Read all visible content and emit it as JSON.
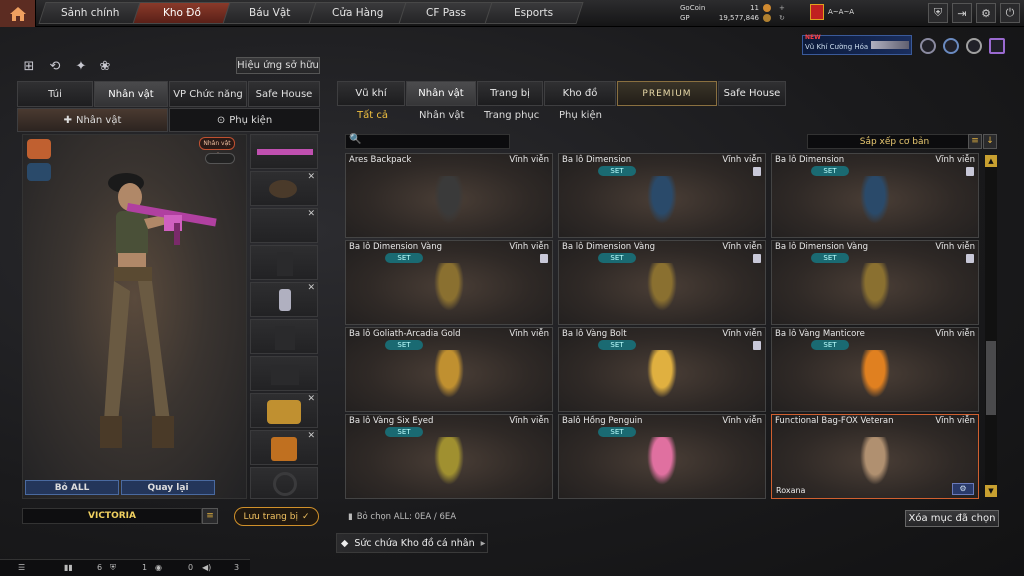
{
  "nav": {
    "tabs": [
      "Sảnh chính",
      "Kho Đồ",
      "Báu Vật",
      "Cửa Hàng",
      "CF Pass",
      "Esports"
    ],
    "active": "Kho Đồ"
  },
  "currency": {
    "gocoin_label": "GoCoin",
    "gocoin": "11",
    "gp_label": "GP",
    "gp": "19,577,846"
  },
  "player": {
    "nick": "A~A~A"
  },
  "promo": {
    "new": "NEW",
    "text": "Vũ Khí Cường Hóa"
  },
  "left": {
    "effects_button": "Hiệu ứng sở hữu",
    "tabs": [
      "Túi",
      "Nhân vật",
      "VP Chức năng",
      "Safe House"
    ],
    "subtabs": [
      "Nhân vật",
      "Phụ kiện"
    ],
    "char_badge": "Nhân vật ✓",
    "remove_all": "Bỏ ALL",
    "back": "Quay lại",
    "preset_name": "VICTORIA",
    "save": "Lưu trang bị"
  },
  "right": {
    "tabs": [
      "Vũ khí",
      "Nhân vật",
      "Trang bị",
      "Kho đồ",
      "PREMIUM",
      "Safe House"
    ],
    "filters": [
      "Tất cả",
      "Nhân vật",
      "Trang phục",
      "Phụ kiện"
    ],
    "sort": "Sắp xếp cơ bản",
    "items": [
      {
        "name": "Ares Backpack",
        "duration": "Vĩnh viễn",
        "set": false,
        "lock": false
      },
      {
        "name": "Ba lô Dimension",
        "duration": "Vĩnh viễn",
        "set": true,
        "lock": true
      },
      {
        "name": "Ba lô Dimension",
        "duration": "Vĩnh viễn",
        "set": true,
        "lock": true
      },
      {
        "name": "Ba lô Dimension Vàng",
        "duration": "Vĩnh viễn",
        "set": true,
        "lock": true
      },
      {
        "name": "Ba lô Dimension Vàng",
        "duration": "Vĩnh viễn",
        "set": true,
        "lock": true
      },
      {
        "name": "Ba lô Dimension Vàng",
        "duration": "Vĩnh viễn",
        "set": true,
        "lock": true
      },
      {
        "name": "Ba lô Goliath-Arcadia Gold",
        "duration": "Vĩnh viễn",
        "set": true,
        "lock": false
      },
      {
        "name": "Ba lô Vàng Bolt",
        "duration": "Vĩnh viễn",
        "set": true,
        "lock": true
      },
      {
        "name": "Ba lô Vàng Manticore",
        "duration": "Vĩnh viễn",
        "set": true,
        "lock": false
      },
      {
        "name": "Ba lô Vàng Six Eyed",
        "duration": "Vĩnh viễn",
        "set": true,
        "lock": false
      },
      {
        "name": "Balô Hồng Penguin",
        "duration": "Vĩnh viễn",
        "set": true,
        "lock": false
      },
      {
        "name": "Functional Bag-FOX Veteran",
        "duration": "Vĩnh viễn",
        "set": false,
        "lock": false,
        "owner": "Roxana"
      }
    ],
    "select_all": "Bỏ chọn ALL: 0EA / 6EA",
    "clear": "Xóa mục đã chọn",
    "capacity": "Sức chứa Kho đồ cá nhân"
  },
  "status": {
    "a": "6",
    "b": "1",
    "c": "0",
    "d": "3"
  }
}
